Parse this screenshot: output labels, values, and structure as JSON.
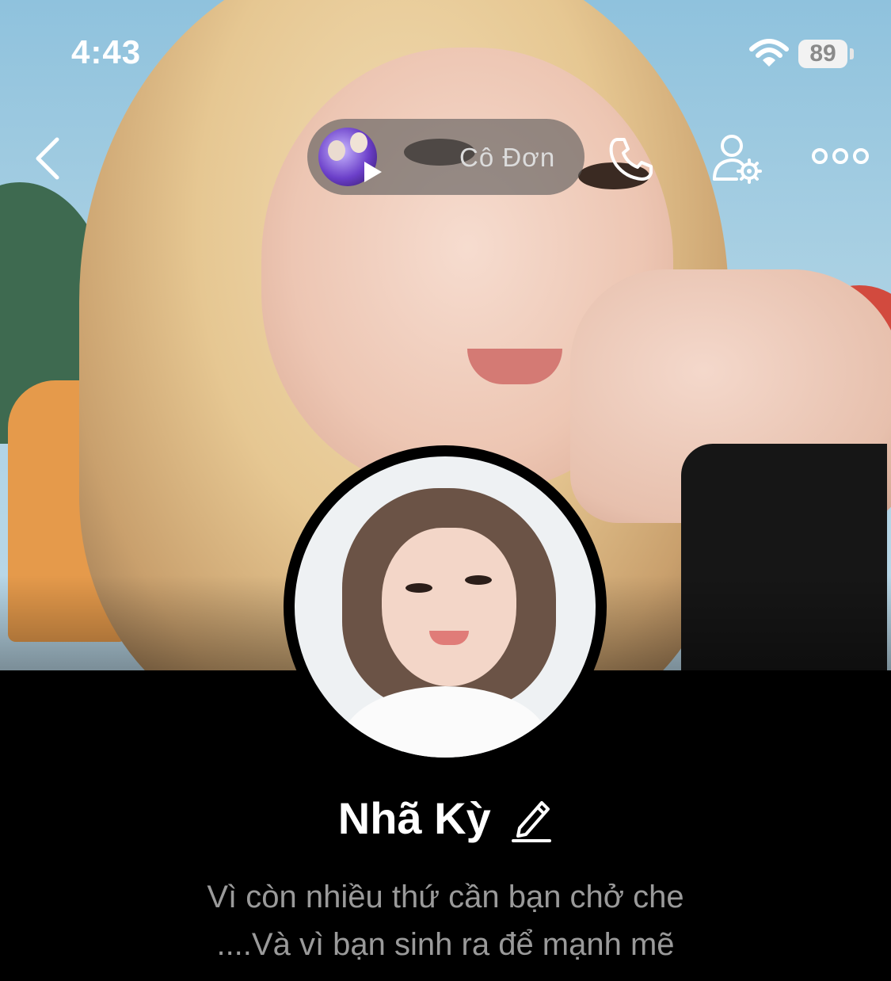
{
  "status_bar": {
    "time": "4:43",
    "battery": "89"
  },
  "music": {
    "title": "Cô Đơn"
  },
  "profile": {
    "name": "Nhã Kỳ",
    "bio_line1": "Vì còn nhiều thứ cần bạn chở che",
    "bio_line2": "....Và vì bạn sinh ra để mạnh mẽ"
  },
  "icons": [
    "back-icon",
    "play-icon",
    "call-icon",
    "user-settings-icon",
    "more-icon",
    "edit-icon",
    "wifi-icon",
    "battery-icon"
  ],
  "colors": {
    "background": "#000000",
    "bio_text": "#9a9a9a",
    "pill_bg": "#5a5a5a"
  }
}
